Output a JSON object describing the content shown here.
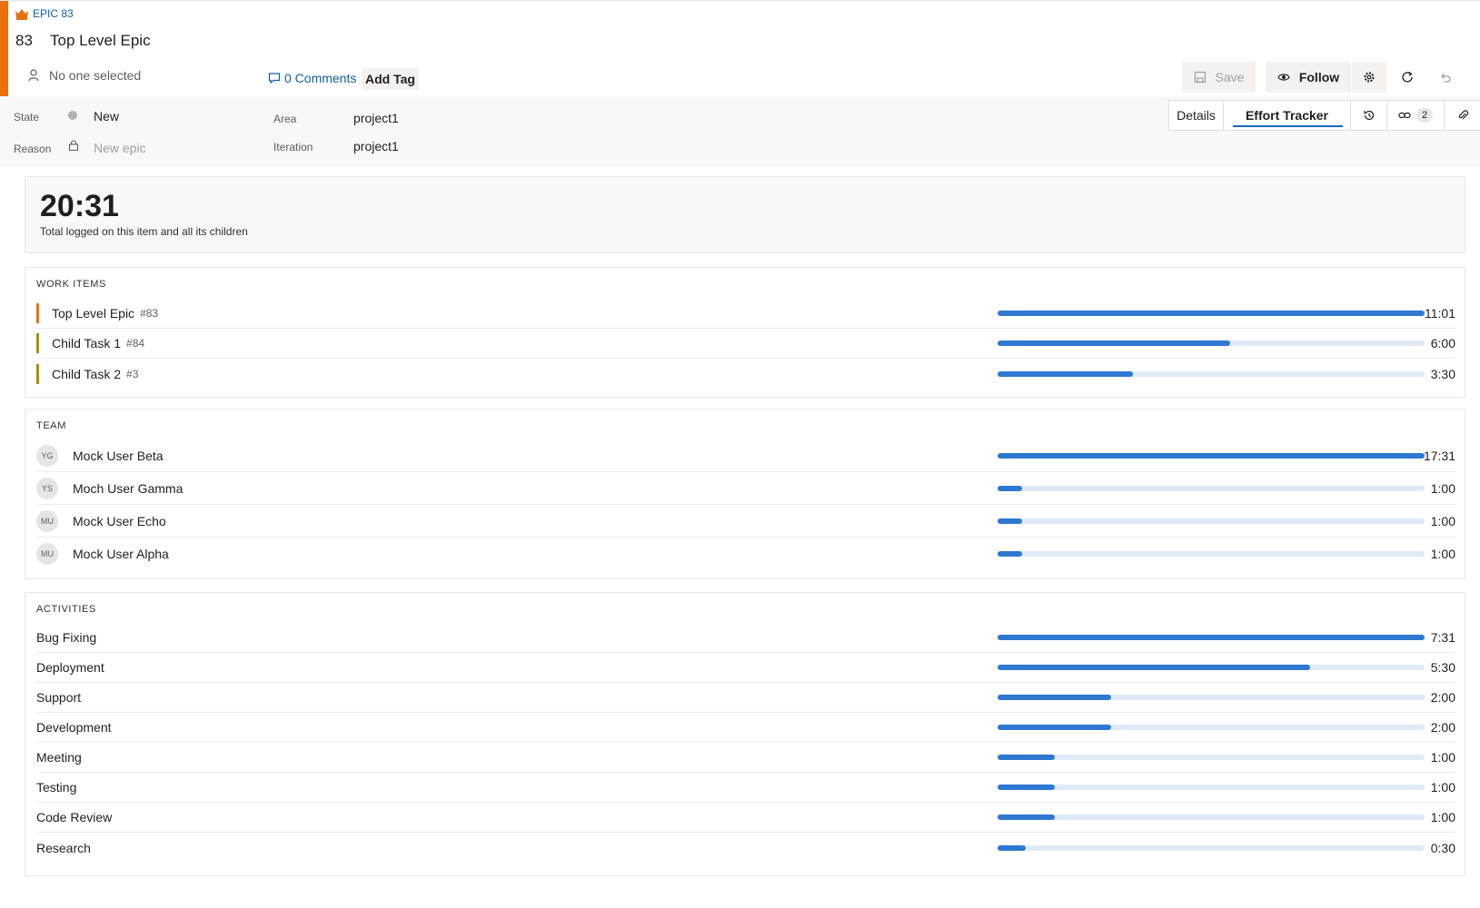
{
  "header": {
    "type_label": "EPIC 83",
    "id": "83",
    "title": "Top Level Epic",
    "assignee": "No one selected",
    "comments": "0 Comments",
    "add_tag": "Add Tag",
    "save_label": "Save",
    "follow_label": "Follow"
  },
  "fields": {
    "state_label": "State",
    "state_value": "New",
    "reason_label": "Reason",
    "reason_value": "New epic",
    "area_label": "Area",
    "area_value": "project1",
    "iteration_label": "Iteration",
    "iteration_value": "project1"
  },
  "tabs": {
    "details": "Details",
    "effort": "Effort Tracker",
    "links_count": "2"
  },
  "summary": {
    "total": "20:31",
    "subtitle": "Total logged on this item and all its children"
  },
  "work_items": {
    "title": "WORK ITEMS",
    "rows": [
      {
        "name": "Top Level Epic",
        "num": "#83",
        "time": "11:01",
        "fraction": 1.0,
        "color": "#e8710a"
      },
      {
        "name": "Child Task 1",
        "num": "#84",
        "time": "6:00",
        "fraction": 0.545,
        "color": "#b5890d"
      },
      {
        "name": "Child Task 2",
        "num": "#3",
        "time": "3:30",
        "fraction": 0.318,
        "color": "#b5890d"
      }
    ]
  },
  "team": {
    "title": "TEAM",
    "rows": [
      {
        "initials": "YG",
        "name": "Mock User Beta",
        "time": "17:31",
        "fraction": 1.0
      },
      {
        "initials": "YS",
        "name": "Moch User Gamma",
        "time": "1:00",
        "fraction": 0.057
      },
      {
        "initials": "MU",
        "name": "Mock User Echo",
        "time": "1:00",
        "fraction": 0.057
      },
      {
        "initials": "MU",
        "name": "Mock User Alpha",
        "time": "1:00",
        "fraction": 0.057
      }
    ]
  },
  "activities": {
    "title": "ACTIVITIES",
    "rows": [
      {
        "name": "Bug Fixing",
        "time": "7:31",
        "fraction": 1.0
      },
      {
        "name": "Deployment",
        "time": "5:30",
        "fraction": 0.732
      },
      {
        "name": "Support",
        "time": "2:00",
        "fraction": 0.266
      },
      {
        "name": "Development",
        "time": "2:00",
        "fraction": 0.266
      },
      {
        "name": "Meeting",
        "time": "1:00",
        "fraction": 0.133
      },
      {
        "name": "Testing",
        "time": "1:00",
        "fraction": 0.133
      },
      {
        "name": "Code Review",
        "time": "1:00",
        "fraction": 0.133
      },
      {
        "name": "Research",
        "time": "0:30",
        "fraction": 0.067
      }
    ]
  },
  "colors": {
    "accent": "#e8710a",
    "bar": "#2e78d2",
    "bar_track": "#dfeaf6",
    "link": "#0e5fa8"
  }
}
